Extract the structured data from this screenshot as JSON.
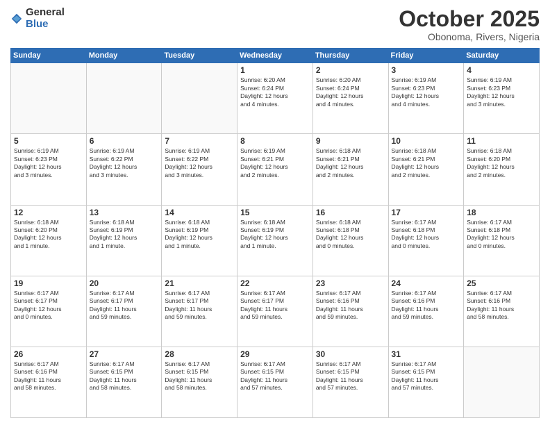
{
  "logo": {
    "general": "General",
    "blue": "Blue"
  },
  "header": {
    "month": "October 2025",
    "location": "Obonoma, Rivers, Nigeria"
  },
  "weekdays": [
    "Sunday",
    "Monday",
    "Tuesday",
    "Wednesday",
    "Thursday",
    "Friday",
    "Saturday"
  ],
  "weeks": [
    [
      {
        "day": "",
        "detail": ""
      },
      {
        "day": "",
        "detail": ""
      },
      {
        "day": "",
        "detail": ""
      },
      {
        "day": "1",
        "detail": "Sunrise: 6:20 AM\nSunset: 6:24 PM\nDaylight: 12 hours\nand 4 minutes."
      },
      {
        "day": "2",
        "detail": "Sunrise: 6:20 AM\nSunset: 6:24 PM\nDaylight: 12 hours\nand 4 minutes."
      },
      {
        "day": "3",
        "detail": "Sunrise: 6:19 AM\nSunset: 6:23 PM\nDaylight: 12 hours\nand 4 minutes."
      },
      {
        "day": "4",
        "detail": "Sunrise: 6:19 AM\nSunset: 6:23 PM\nDaylight: 12 hours\nand 3 minutes."
      }
    ],
    [
      {
        "day": "5",
        "detail": "Sunrise: 6:19 AM\nSunset: 6:23 PM\nDaylight: 12 hours\nand 3 minutes."
      },
      {
        "day": "6",
        "detail": "Sunrise: 6:19 AM\nSunset: 6:22 PM\nDaylight: 12 hours\nand 3 minutes."
      },
      {
        "day": "7",
        "detail": "Sunrise: 6:19 AM\nSunset: 6:22 PM\nDaylight: 12 hours\nand 3 minutes."
      },
      {
        "day": "8",
        "detail": "Sunrise: 6:19 AM\nSunset: 6:21 PM\nDaylight: 12 hours\nand 2 minutes."
      },
      {
        "day": "9",
        "detail": "Sunrise: 6:18 AM\nSunset: 6:21 PM\nDaylight: 12 hours\nand 2 minutes."
      },
      {
        "day": "10",
        "detail": "Sunrise: 6:18 AM\nSunset: 6:21 PM\nDaylight: 12 hours\nand 2 minutes."
      },
      {
        "day": "11",
        "detail": "Sunrise: 6:18 AM\nSunset: 6:20 PM\nDaylight: 12 hours\nand 2 minutes."
      }
    ],
    [
      {
        "day": "12",
        "detail": "Sunrise: 6:18 AM\nSunset: 6:20 PM\nDaylight: 12 hours\nand 1 minute."
      },
      {
        "day": "13",
        "detail": "Sunrise: 6:18 AM\nSunset: 6:19 PM\nDaylight: 12 hours\nand 1 minute."
      },
      {
        "day": "14",
        "detail": "Sunrise: 6:18 AM\nSunset: 6:19 PM\nDaylight: 12 hours\nand 1 minute."
      },
      {
        "day": "15",
        "detail": "Sunrise: 6:18 AM\nSunset: 6:19 PM\nDaylight: 12 hours\nand 1 minute."
      },
      {
        "day": "16",
        "detail": "Sunrise: 6:18 AM\nSunset: 6:18 PM\nDaylight: 12 hours\nand 0 minutes."
      },
      {
        "day": "17",
        "detail": "Sunrise: 6:17 AM\nSunset: 6:18 PM\nDaylight: 12 hours\nand 0 minutes."
      },
      {
        "day": "18",
        "detail": "Sunrise: 6:17 AM\nSunset: 6:18 PM\nDaylight: 12 hours\nand 0 minutes."
      }
    ],
    [
      {
        "day": "19",
        "detail": "Sunrise: 6:17 AM\nSunset: 6:17 PM\nDaylight: 12 hours\nand 0 minutes."
      },
      {
        "day": "20",
        "detail": "Sunrise: 6:17 AM\nSunset: 6:17 PM\nDaylight: 11 hours\nand 59 minutes."
      },
      {
        "day": "21",
        "detail": "Sunrise: 6:17 AM\nSunset: 6:17 PM\nDaylight: 11 hours\nand 59 minutes."
      },
      {
        "day": "22",
        "detail": "Sunrise: 6:17 AM\nSunset: 6:17 PM\nDaylight: 11 hours\nand 59 minutes."
      },
      {
        "day": "23",
        "detail": "Sunrise: 6:17 AM\nSunset: 6:16 PM\nDaylight: 11 hours\nand 59 minutes."
      },
      {
        "day": "24",
        "detail": "Sunrise: 6:17 AM\nSunset: 6:16 PM\nDaylight: 11 hours\nand 59 minutes."
      },
      {
        "day": "25",
        "detail": "Sunrise: 6:17 AM\nSunset: 6:16 PM\nDaylight: 11 hours\nand 58 minutes."
      }
    ],
    [
      {
        "day": "26",
        "detail": "Sunrise: 6:17 AM\nSunset: 6:16 PM\nDaylight: 11 hours\nand 58 minutes."
      },
      {
        "day": "27",
        "detail": "Sunrise: 6:17 AM\nSunset: 6:15 PM\nDaylight: 11 hours\nand 58 minutes."
      },
      {
        "day": "28",
        "detail": "Sunrise: 6:17 AM\nSunset: 6:15 PM\nDaylight: 11 hours\nand 58 minutes."
      },
      {
        "day": "29",
        "detail": "Sunrise: 6:17 AM\nSunset: 6:15 PM\nDaylight: 11 hours\nand 57 minutes."
      },
      {
        "day": "30",
        "detail": "Sunrise: 6:17 AM\nSunset: 6:15 PM\nDaylight: 11 hours\nand 57 minutes."
      },
      {
        "day": "31",
        "detail": "Sunrise: 6:17 AM\nSunset: 6:15 PM\nDaylight: 11 hours\nand 57 minutes."
      },
      {
        "day": "",
        "detail": ""
      }
    ]
  ]
}
